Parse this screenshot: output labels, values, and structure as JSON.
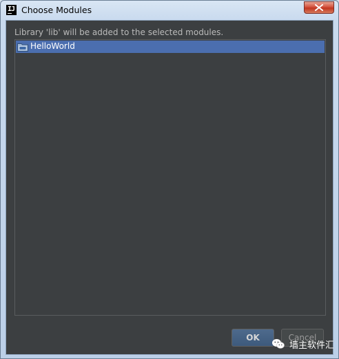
{
  "window": {
    "app_icon_text": "IJ",
    "title": "Choose Modules"
  },
  "dialog": {
    "description": "Library 'lib' will be added to the selected modules.",
    "modules": [
      {
        "label": "HelloWorld",
        "icon": "module-folder-icon",
        "selected": true
      }
    ]
  },
  "buttons": {
    "ok_label": "OK",
    "cancel_label": "Cancel"
  },
  "watermark": {
    "text": "墙主软件汇",
    "icon": "wechat-icon"
  },
  "colors": {
    "dialog_bg": "#3c3f41",
    "selection": "#4b6eaf",
    "text": "#bbbbbb",
    "titlebar": "#c9daee"
  }
}
